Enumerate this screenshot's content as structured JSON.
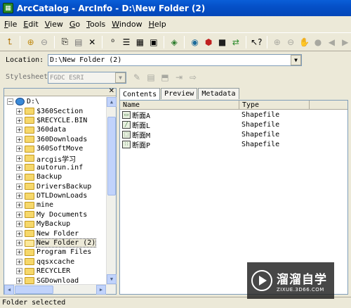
{
  "window": {
    "title": "ArcCatalog - ArcInfo - D:\\New Folder (2)"
  },
  "menu": [
    "File",
    "Edit",
    "View",
    "Go",
    "Tools",
    "Window",
    "Help"
  ],
  "location": {
    "label": "Location:",
    "value": "D:\\New Folder (2)"
  },
  "stylesheet": {
    "label": "Stylesheet:",
    "value": "FGDC ESRI"
  },
  "tree": {
    "root": "D:\\",
    "items": [
      {
        "label": "$360Section",
        "selected": false
      },
      {
        "label": "$RECYCLE.BIN",
        "selected": false
      },
      {
        "label": "360data",
        "selected": false
      },
      {
        "label": "360Downloads",
        "selected": false
      },
      {
        "label": "360SoftMove",
        "selected": false
      },
      {
        "label": "arcgis学习",
        "selected": false
      },
      {
        "label": "autorun.inf",
        "selected": false
      },
      {
        "label": "Backup",
        "selected": false
      },
      {
        "label": "DriversBackup",
        "selected": false
      },
      {
        "label": "DTLDownLoads",
        "selected": false
      },
      {
        "label": "mine",
        "selected": false
      },
      {
        "label": "My Documents",
        "selected": false
      },
      {
        "label": "MyBackup",
        "selected": false
      },
      {
        "label": "New Folder",
        "selected": false
      },
      {
        "label": "New Folder (2)",
        "selected": true
      },
      {
        "label": "Program Files",
        "selected": false
      },
      {
        "label": "qqsxcache",
        "selected": false
      },
      {
        "label": "RECYCLER",
        "selected": false
      },
      {
        "label": "SGDownload",
        "selected": false
      }
    ]
  },
  "tabs": [
    "Contents",
    "Preview",
    "Metadata"
  ],
  "contents": {
    "columns": [
      "Name",
      "Type"
    ],
    "rows": [
      {
        "name": "断面A",
        "type": "Shapefile",
        "icon": "polygon-icon"
      },
      {
        "name": "断面L",
        "type": "Shapefile",
        "icon": "polyline-icon"
      },
      {
        "name": "断面M",
        "type": "Shapefile",
        "icon": "multipatch-icon"
      },
      {
        "name": "断面P",
        "type": "Shapefile",
        "icon": "point-icon"
      }
    ]
  },
  "status": "Folder selected",
  "watermark": {
    "main": "溜溜自学",
    "sub": "ZIXUE.3D66.COM"
  }
}
